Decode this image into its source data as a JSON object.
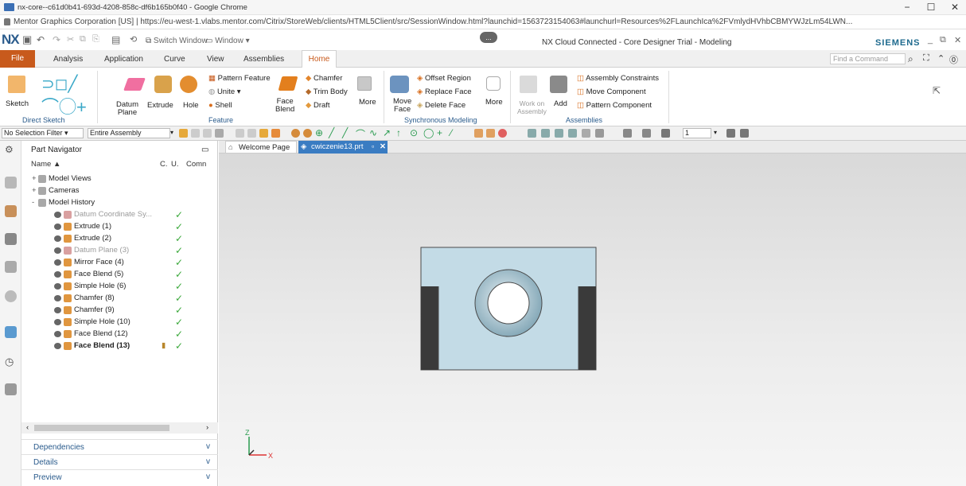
{
  "browser": {
    "title": "nx-core--c61d0b41-693d-4208-858c-df6b165b0f40 - Google Chrome",
    "url": "Mentor Graphics Corporation [US]  |  https://eu-west-1.vlabs.mentor.com/Citrix/StoreWeb/clients/HTML5Client/src/SessionWindow.html?launchid=1563723154063#launchurl=Resources%2FLaunchIca%2FVmlydHVhbCBMYWJzLm54LWN..."
  },
  "qat": {
    "logo": "NX",
    "switch_window": "Switch Window",
    "window": "Window",
    "title": "NX Cloud Connected - Core Designer Trial - Modeling",
    "brand": "SIEMENS",
    "pill": "..."
  },
  "tabs": {
    "file": "File",
    "analysis": "Analysis",
    "application": "Application",
    "curve": "Curve",
    "view": "View",
    "assemblies": "Assemblies",
    "home": "Home",
    "find_placeholder": "Find a Command"
  },
  "ribbon": {
    "sketch": "Sketch",
    "direct_sketch": "Direct Sketch",
    "datum_plane": "Datum\nPlane",
    "extrude": "Extrude",
    "hole": "Hole",
    "pattern_feature": "Pattern Feature",
    "unite": "Unite",
    "shell": "Shell",
    "face_blend": "Face\nBlend",
    "feature": "Feature",
    "chamfer": "Chamfer",
    "trim_body": "Trim Body",
    "draft": "Draft",
    "more1": "More",
    "move_face": "Move\nFace",
    "offset_region": "Offset Region",
    "replace_face": "Replace Face",
    "delete_face": "Delete Face",
    "more2": "More",
    "synchronous_modeling": "Synchronous Modeling",
    "work_on_assembly": "Work on\nAssembly",
    "add": "Add",
    "assembly_constraints": "Assembly Constraints",
    "move_component": "Move Component",
    "pattern_component": "Pattern Component",
    "assemblies": "Assemblies"
  },
  "selection": {
    "filter": "No Selection Filter",
    "scope": "Entire Assembly",
    "number": "1"
  },
  "navigator": {
    "title": "Part Navigator",
    "columns": [
      "Name",
      "C.",
      "U.",
      "Comn"
    ],
    "rows": [
      {
        "label": "Model Views",
        "indent": 1,
        "check": false,
        "gray": false,
        "bold": false,
        "expander": "+"
      },
      {
        "label": "Cameras",
        "indent": 1,
        "check": false,
        "gray": false,
        "bold": false,
        "expander": "+"
      },
      {
        "label": "Model History",
        "indent": 1,
        "check": false,
        "gray": false,
        "bold": false,
        "expander": "-"
      },
      {
        "label": "Datum Coordinate Sy...",
        "indent": 2,
        "check": true,
        "gray": true,
        "bold": false,
        "expander": ""
      },
      {
        "label": "Extrude (1)",
        "indent": 2,
        "check": true,
        "gray": false,
        "bold": false,
        "expander": ""
      },
      {
        "label": "Extrude (2)",
        "indent": 2,
        "check": true,
        "gray": false,
        "bold": false,
        "expander": ""
      },
      {
        "label": "Datum Plane (3)",
        "indent": 2,
        "check": true,
        "gray": true,
        "bold": false,
        "expander": ""
      },
      {
        "label": "Mirror Face (4)",
        "indent": 2,
        "check": true,
        "gray": false,
        "bold": false,
        "expander": ""
      },
      {
        "label": "Face Blend (5)",
        "indent": 2,
        "check": true,
        "gray": false,
        "bold": false,
        "expander": ""
      },
      {
        "label": "Simple Hole (6)",
        "indent": 2,
        "check": true,
        "gray": false,
        "bold": false,
        "expander": ""
      },
      {
        "label": "Chamfer (8)",
        "indent": 2,
        "check": true,
        "gray": false,
        "bold": false,
        "expander": ""
      },
      {
        "label": "Chamfer (9)",
        "indent": 2,
        "check": true,
        "gray": false,
        "bold": false,
        "expander": ""
      },
      {
        "label": "Simple Hole (10)",
        "indent": 2,
        "check": true,
        "gray": false,
        "bold": false,
        "expander": ""
      },
      {
        "label": "Face Blend (12)",
        "indent": 2,
        "check": true,
        "gray": false,
        "bold": false,
        "expander": ""
      },
      {
        "label": "Face Blend (13)",
        "indent": 2,
        "check": true,
        "gray": false,
        "bold": true,
        "expander": ""
      }
    ],
    "dependencies": "Dependencies",
    "details": "Details",
    "preview": "Preview"
  },
  "viewport": {
    "welcome_tab": "Welcome Page",
    "part_tab": "cwiczenie13.prt",
    "axis_z": "Z",
    "axis_x": "X"
  },
  "colors": {
    "accent": "#c85a1c",
    "nx_blue": "#2a5b8c",
    "model_face": "#c3dbe6",
    "model_edge": "#4a4a4a"
  }
}
